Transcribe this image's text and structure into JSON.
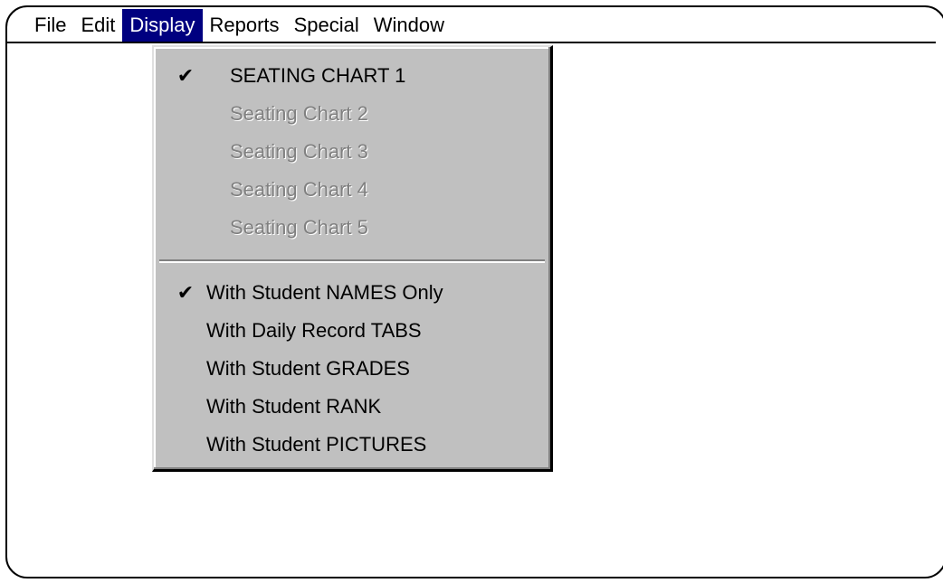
{
  "menubar": {
    "items": [
      {
        "label": "File"
      },
      {
        "label": "Edit"
      },
      {
        "label": "Display"
      },
      {
        "label": "Reports"
      },
      {
        "label": "Special"
      },
      {
        "label": "Window"
      }
    ]
  },
  "display_menu": {
    "seating_charts": [
      {
        "label": "SEATING CHART 1",
        "checked": true,
        "enabled": true
      },
      {
        "label": "Seating Chart 2",
        "checked": false,
        "enabled": false
      },
      {
        "label": "Seating Chart 3",
        "checked": false,
        "enabled": false
      },
      {
        "label": "Seating Chart 4",
        "checked": false,
        "enabled": false
      },
      {
        "label": "Seating Chart 5",
        "checked": false,
        "enabled": false
      }
    ],
    "view_options": [
      {
        "label": "With Student NAMES Only",
        "checked": true,
        "enabled": true
      },
      {
        "label": "With Daily Record TABS",
        "checked": false,
        "enabled": true
      },
      {
        "label": "With Student GRADES",
        "checked": false,
        "enabled": true
      },
      {
        "label": "With Student RANK",
        "checked": false,
        "enabled": true
      },
      {
        "label": "With Student PICTURES",
        "checked": false,
        "enabled": true
      }
    ],
    "check_glyph": "✔"
  },
  "colors": {
    "menu_highlight": "#000080",
    "menu_background": "#c0c0c0",
    "disabled_text": "#808080"
  }
}
